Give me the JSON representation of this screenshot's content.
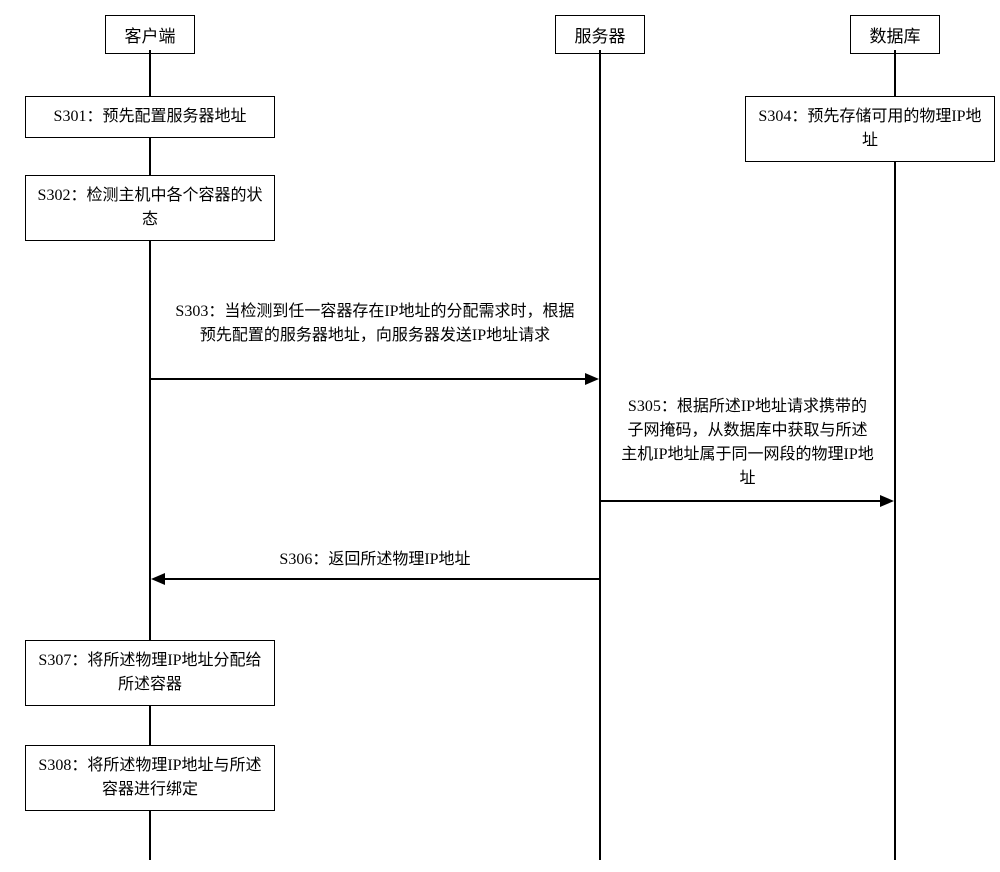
{
  "participants": {
    "client": "客户端",
    "server": "服务器",
    "database": "数据库"
  },
  "steps": {
    "s301": "S301：预先配置服务器地址",
    "s302": "S302：检测主机中各个容器的状态",
    "s303": "S303：当检测到任一容器存在IP地址的分配需求时，根据预先配置的服务器地址，向服务器发送IP地址请求",
    "s304": "S304：预先存储可用的物理IP地址",
    "s305": "S305：根据所述IP地址请求携带的子网掩码，从数据库中获取与所述主机IP地址属于同一网段的物理IP地址",
    "s306": "S306：返回所述物理IP地址",
    "s307": "S307：将所述物理IP地址分配给所述容器",
    "s308": "S308：将所述物理IP地址与所述容器进行绑定"
  }
}
